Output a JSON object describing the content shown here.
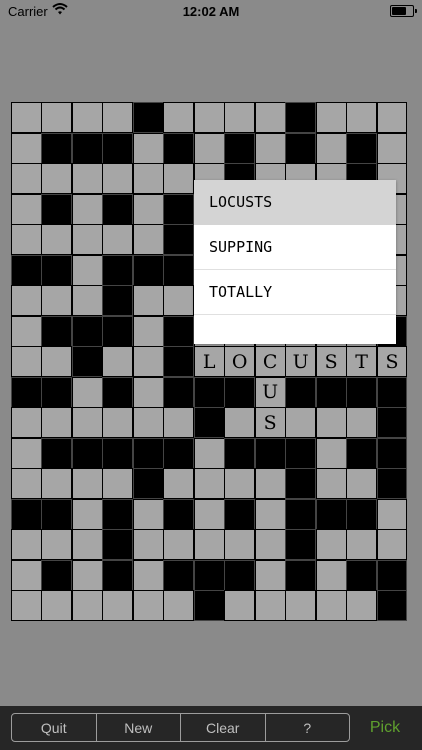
{
  "status_bar": {
    "carrier": "Carrier",
    "time": "12:02 AM"
  },
  "grid": {
    "rows": 17,
    "cols": 13,
    "black_cells": [
      [
        0,
        4
      ],
      [
        0,
        9
      ],
      [
        1,
        1
      ],
      [
        1,
        2
      ],
      [
        1,
        3
      ],
      [
        1,
        5
      ],
      [
        1,
        7
      ],
      [
        1,
        9
      ],
      [
        1,
        11
      ],
      [
        2,
        7
      ],
      [
        2,
        11
      ],
      [
        3,
        1
      ],
      [
        3,
        3
      ],
      [
        3,
        5
      ],
      [
        4,
        5
      ],
      [
        5,
        0
      ],
      [
        5,
        1
      ],
      [
        5,
        3
      ],
      [
        5,
        4
      ],
      [
        5,
        5
      ],
      [
        6,
        3
      ],
      [
        7,
        1
      ],
      [
        7,
        2
      ],
      [
        7,
        3
      ],
      [
        7,
        5
      ],
      [
        7,
        12
      ],
      [
        8,
        2
      ],
      [
        8,
        5
      ],
      [
        9,
        0
      ],
      [
        9,
        1
      ],
      [
        9,
        3
      ],
      [
        9,
        5
      ],
      [
        9,
        6
      ],
      [
        9,
        7
      ],
      [
        9,
        9
      ],
      [
        9,
        10
      ],
      [
        9,
        11
      ],
      [
        9,
        12
      ],
      [
        10,
        6
      ],
      [
        10,
        12
      ],
      [
        11,
        1
      ],
      [
        11,
        2
      ],
      [
        11,
        3
      ],
      [
        11,
        4
      ],
      [
        11,
        5
      ],
      [
        11,
        7
      ],
      [
        11,
        8
      ],
      [
        11,
        9
      ],
      [
        11,
        11
      ],
      [
        11,
        12
      ],
      [
        12,
        4
      ],
      [
        12,
        9
      ],
      [
        12,
        12
      ],
      [
        13,
        0
      ],
      [
        13,
        1
      ],
      [
        13,
        3
      ],
      [
        13,
        5
      ],
      [
        13,
        7
      ],
      [
        13,
        9
      ],
      [
        13,
        10
      ],
      [
        13,
        11
      ],
      [
        14,
        3
      ],
      [
        14,
        9
      ],
      [
        15,
        1
      ],
      [
        15,
        3
      ],
      [
        15,
        5
      ],
      [
        15,
        6
      ],
      [
        15,
        7
      ],
      [
        15,
        9
      ],
      [
        15,
        11
      ],
      [
        15,
        12
      ],
      [
        16,
        6
      ],
      [
        16,
        12
      ]
    ],
    "letters": [
      {
        "row": 8,
        "col": 6,
        "ch": "L"
      },
      {
        "row": 8,
        "col": 7,
        "ch": "O"
      },
      {
        "row": 8,
        "col": 8,
        "ch": "C"
      },
      {
        "row": 8,
        "col": 9,
        "ch": "U"
      },
      {
        "row": 8,
        "col": 10,
        "ch": "S"
      },
      {
        "row": 8,
        "col": 11,
        "ch": "T"
      },
      {
        "row": 8,
        "col": 12,
        "ch": "S"
      },
      {
        "row": 9,
        "col": 8,
        "ch": "U"
      },
      {
        "row": 10,
        "col": 8,
        "ch": "S"
      }
    ]
  },
  "picker": {
    "items": [
      {
        "label": "LOCUSTS",
        "selected": true
      },
      {
        "label": "SUPPING",
        "selected": false
      },
      {
        "label": "TOTALLY",
        "selected": false
      },
      {
        "label": "",
        "selected": false
      }
    ]
  },
  "toolbar": {
    "quit": "Quit",
    "new": "New",
    "clear": "Clear",
    "help": "?",
    "pick": "Pick",
    "pick_color": "#5fa02e"
  }
}
